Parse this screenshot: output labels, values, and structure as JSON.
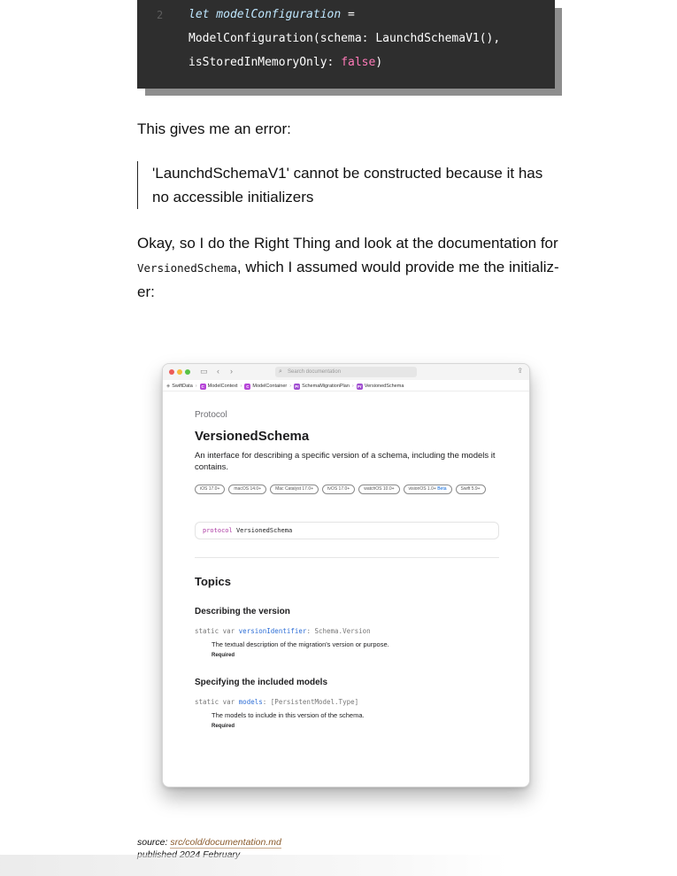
{
  "code": {
    "line_number": "2",
    "line1_keyword": "let modelConfiguration",
    "line1_rest": " =",
    "line2": "ModelConfiguration(schema: LaunchdSchemaV1(),",
    "line3_prefix": "isStoredInMemoryOnly: ",
    "line3_value": "false",
    "line3_suffix": ")"
  },
  "article": {
    "para1": "This gives me an error:",
    "quote": "'LaunchdSchemaV1' cannot be constructed because it has no accessible initializers",
    "para2_before": "Okay, so I do the Right Thing and look at the documentation for",
    "para2_code": "VersionedSchema",
    "para2_after": ", which I assumed would provide me the initializ-",
    "para2_end": "er:"
  },
  "screenshot": {
    "search_placeholder": "Search documentation",
    "breadcrumbs": [
      {
        "label": "SwiftData",
        "badge": ""
      },
      {
        "label": "ModelContext",
        "badge": "C"
      },
      {
        "label": "ModelContainer",
        "badge": "C"
      },
      {
        "label": "SchemaMigrationPlan",
        "badge": "Pr"
      },
      {
        "label": "VersionedSchema",
        "badge": "Pr"
      }
    ],
    "kind": "Protocol",
    "title": "VersionedSchema",
    "description": "An interface for describing a specific version of a schema, including the models it contains.",
    "platforms": [
      "iOS 17.0+",
      "macOS 14.0+",
      "Mac Catalyst 17.0+",
      "tvOS 17.0+",
      "watchOS 10.0+",
      "visionOS 1.0+",
      "Swift 5.9+"
    ],
    "beta_label": "Beta",
    "declaration_keyword": "protocol",
    "declaration_name": "VersionedSchema",
    "topics_heading": "Topics",
    "sections": [
      {
        "heading": "Describing the version",
        "sig_prefix": "static var ",
        "sig_symbol": "versionIdentifier",
        "sig_suffix": ": Schema.Version",
        "description": "The textual description of the migration's version or purpose.",
        "required": "Required"
      },
      {
        "heading": "Specifying the included models",
        "sig_prefix": "static var ",
        "sig_symbol": "models",
        "sig_suffix": ": [PersistentModel.Type]",
        "description": "The models to include in this version of the schema.",
        "required": "Required"
      }
    ]
  },
  "footer": {
    "source_label": "source: ",
    "source_link": "src/cold/documentation.md",
    "published": "published 2024 February"
  }
}
